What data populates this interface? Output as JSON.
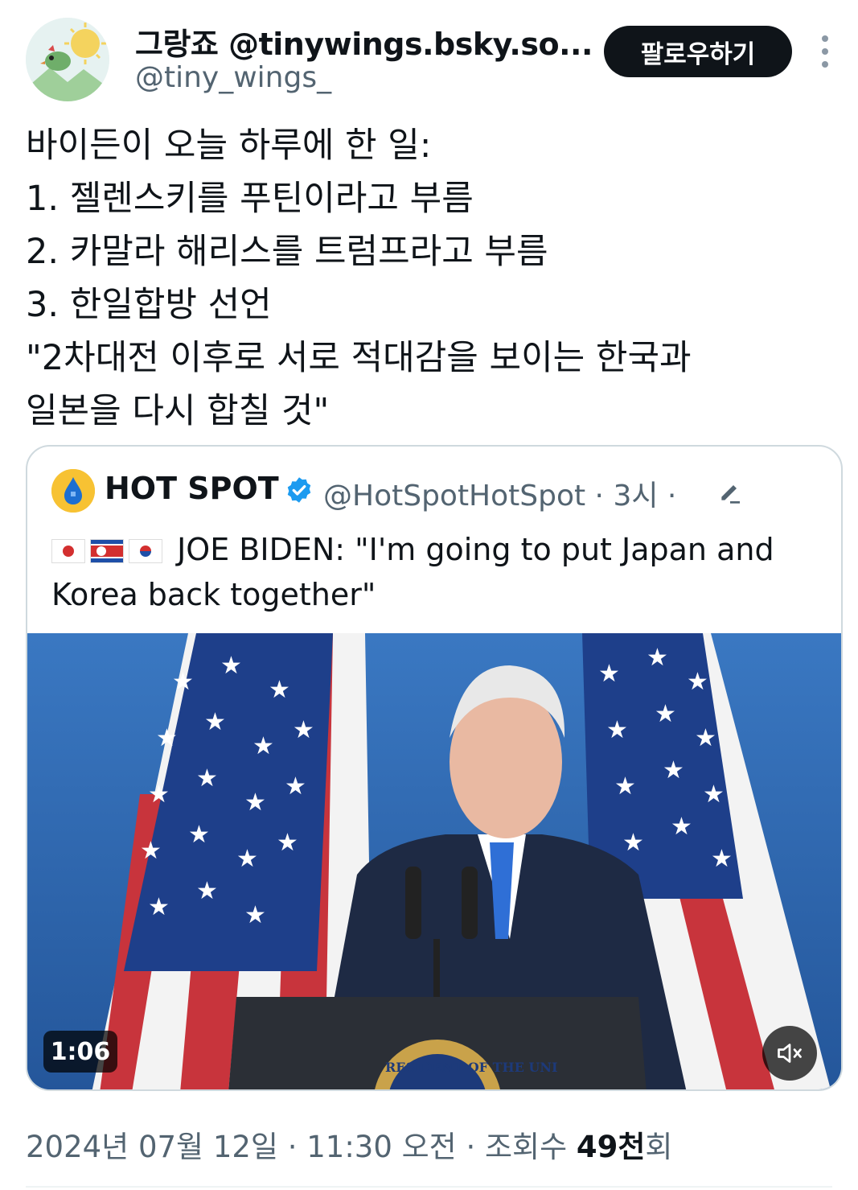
{
  "author": {
    "display_name": "그랑죠 @tinywings.bsky.so...",
    "handle": "@tiny_wings_",
    "avatar_icon": "bird-sun-avatar-icon"
  },
  "follow_button_label": "팔로우하기",
  "more_icon": "more-vertical-icon",
  "tweet_lines": [
    "바이든이 오늘 하루에 한 일:",
    "1. 젤렌스키를 푸틴이라고 부름",
    "2. 카말라 해리스를 트럼프라고 부름",
    "3. 한일합방 선언",
    "\"2차대전 이후로 서로 적대감을 보이는 한국과",
    "일본을 다시 합칠 것\""
  ],
  "quote": {
    "display_name": "HOT SPOT",
    "handle_meta": "@HotSpotHotSpot · 3시 ·",
    "verified_color": "#1d9bf0",
    "flags": [
      "japan-flag-icon",
      "north-korea-flag-icon",
      "south-korea-flag-icon"
    ],
    "text_line1": "JOE BIDEN: \"I'm going to put Japan and",
    "text_line2": "Korea back together\"",
    "video": {
      "timecode": "1:06",
      "mute_icon": "speaker-muted-icon",
      "seal_text": "RESIDENT OF THE UNI"
    }
  },
  "footer": {
    "datetime": "2024년 07월 12일 · 11:30 오전 · 조회수 ",
    "views_bold": "49천",
    "views_suffix": "회"
  }
}
